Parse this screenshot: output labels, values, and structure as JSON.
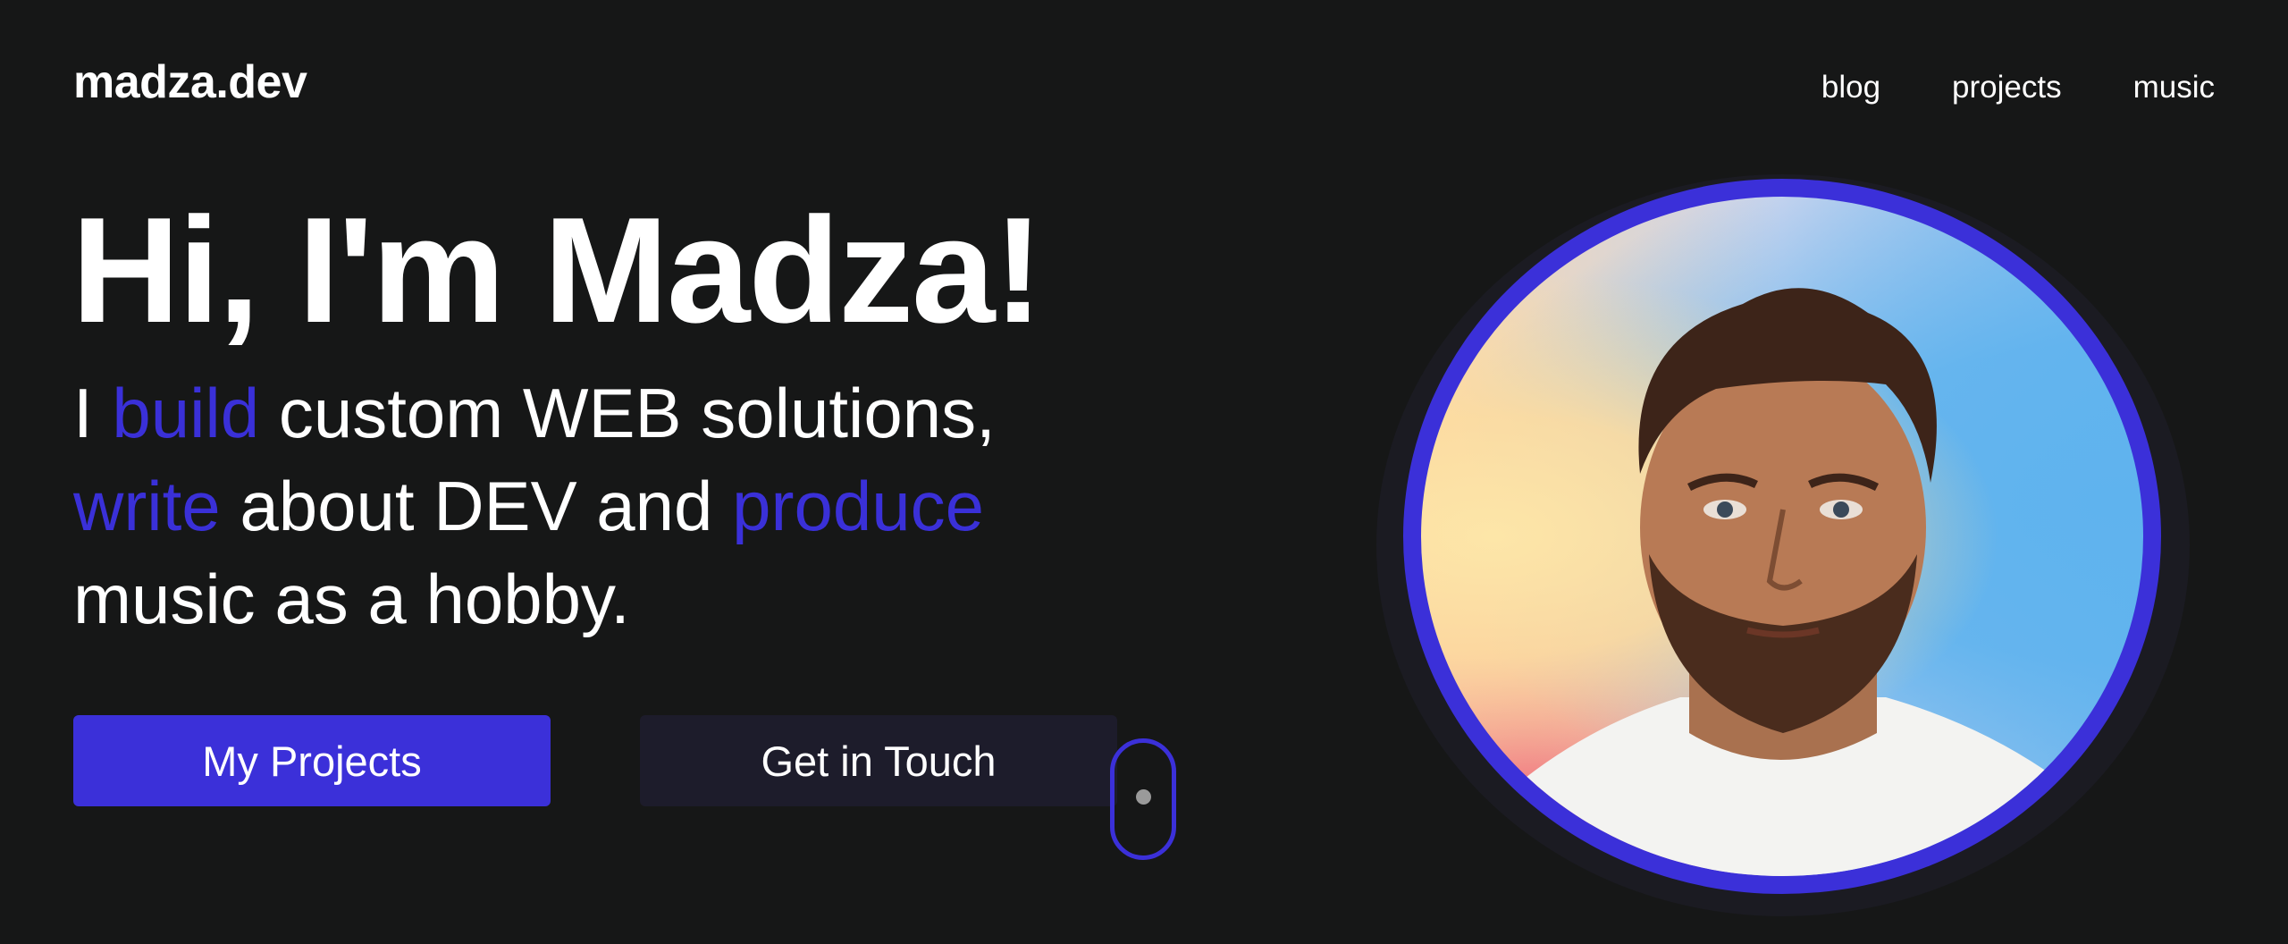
{
  "header": {
    "logo": "madza.dev",
    "nav": [
      {
        "label": "blog"
      },
      {
        "label": "projects"
      },
      {
        "label": "music"
      }
    ]
  },
  "hero": {
    "title": "Hi, I'm Madza!",
    "subtitle": {
      "p1": "I ",
      "a1": "build",
      "p2": " custom WEB solutions,",
      "a2": "write",
      "p3": " about DEV and ",
      "a3": "produce",
      "p4": "music as a hobby."
    },
    "buttons": {
      "primary": "My Projects",
      "secondary": "Get in Touch"
    }
  },
  "colors": {
    "background": "#161717",
    "accent": "#3b30d9",
    "secondary_button": "#1d1c2b",
    "text": "#ffffff"
  },
  "icons": {
    "scroll": "scroll-mouse-icon",
    "avatar": "avatar-portrait"
  }
}
